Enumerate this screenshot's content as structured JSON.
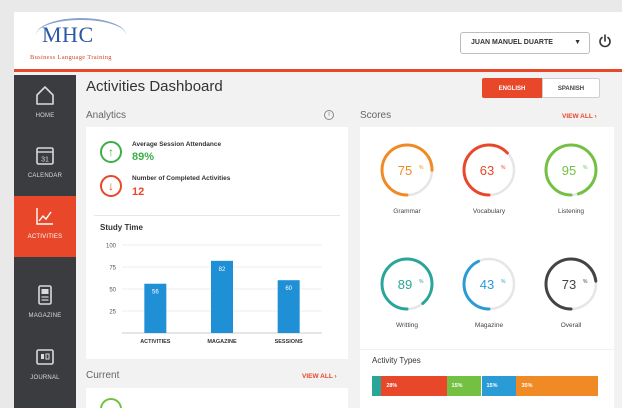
{
  "header": {
    "logo_text": "MHC",
    "tagline": "Business Language Training",
    "user_name": "JUAN MANUEL DUARTE",
    "accent": "#e8472a"
  },
  "sidebar": {
    "items": [
      {
        "label": "HOME",
        "icon": "home-icon",
        "active": false
      },
      {
        "label": "CALENDAR",
        "icon": "calendar-icon",
        "icon_text": "31",
        "active": false
      },
      {
        "label": "ACTIVITIES",
        "icon": "activities-chart-icon",
        "active": true
      },
      {
        "label": "MAGAZINE",
        "icon": "magazine-icon",
        "active": false
      },
      {
        "label": "JOURNAL",
        "icon": "journal-icon",
        "active": false
      }
    ]
  },
  "main": {
    "title": "Activities Dashboard",
    "languages": [
      "ENGLISH",
      "SPANISH"
    ],
    "selected_language": "ENGLISH"
  },
  "analytics": {
    "label": "Analytics",
    "stats": [
      {
        "label": "Average Session Attendance",
        "value": "89%",
        "trend": "up",
        "color": "#3dae49"
      },
      {
        "label": "Number of Completed Activities",
        "value": "12",
        "trend": "down",
        "color": "#e8472a"
      }
    ]
  },
  "scores": {
    "label": "Scores",
    "view_all": "VIEW ALL",
    "items": [
      {
        "label": "Grammar",
        "value": 75,
        "display": "75",
        "color": "#f08a24"
      },
      {
        "label": "Vocabulary",
        "value": 63,
        "display": "63",
        "color": "#e8472a"
      },
      {
        "label": "Listening",
        "value": 95,
        "display": "95",
        "color": "#74c043"
      },
      {
        "label": "Writting",
        "value": 89,
        "display": "89",
        "color": "#2aa59a"
      },
      {
        "label": "Magazine",
        "value": 43,
        "display": "43",
        "color": "#2b9bd6"
      },
      {
        "label": "Overall",
        "value": 73,
        "display": "73",
        "color": "#444444"
      }
    ]
  },
  "current": {
    "label": "Current",
    "view_all": "VIEW ALL"
  },
  "activity_types": {
    "label": "Activity Types",
    "segments": [
      {
        "label": "",
        "value": 4,
        "color": "#2aa59a"
      },
      {
        "label": "28%",
        "value": 28,
        "color": "#e8472a"
      },
      {
        "label": "15%",
        "value": 15,
        "color": "#74c043"
      },
      {
        "label": "15%",
        "value": 15,
        "color": "#2b9bd6"
      },
      {
        "label": "35%",
        "value": 35,
        "color": "#f08a24"
      }
    ]
  },
  "chart_data": {
    "type": "bar",
    "title": "Study Time",
    "categories": [
      "ACTIVITIES",
      "MAGAZINE",
      "SESSIONS"
    ],
    "values": [
      56,
      82,
      60
    ],
    "ylim": [
      0,
      100
    ],
    "yticks": [
      "100",
      "75",
      "50",
      "25"
    ],
    "color": "#1f8fd6"
  }
}
